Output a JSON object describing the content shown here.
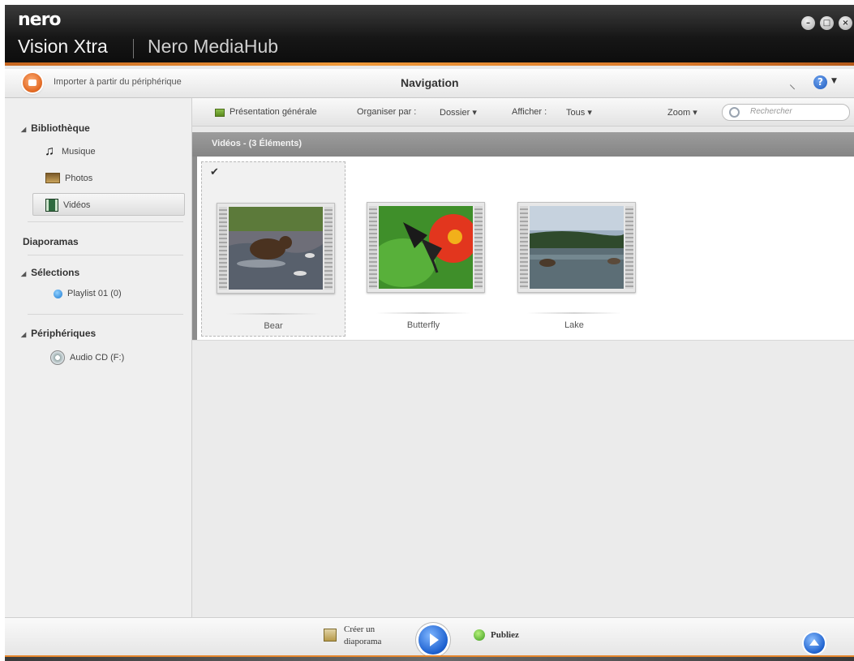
{
  "titlebar": {
    "logo": "nero",
    "app_name": "Vision Xtra",
    "app_secondary": "Nero MediaHub",
    "window_buttons": [
      "minimize-icon",
      "maximize-icon",
      "close-icon"
    ]
  },
  "navbar": {
    "import_label": "Importer à partir du périphérique",
    "title": "Navigation"
  },
  "sidebar": {
    "library_header": "Bibliothèque",
    "library_items": [
      {
        "label": "Musique",
        "icon": "music-note-icon"
      },
      {
        "label": "Photos",
        "icon": "photos-icon"
      },
      {
        "label": "Vidéos",
        "icon": "video-icon",
        "selected": true
      }
    ],
    "slideshows_header": "Diaporamas",
    "selections_header": "Sélections",
    "selections_items": [
      {
        "label": "Playlist 01 (0)",
        "icon": "playlist-icon"
      }
    ],
    "devices_header": "Périphériques",
    "devices_items": [
      {
        "label": "Audio CD (F:)",
        "icon": "cd-drive-icon"
      }
    ]
  },
  "toolbar": {
    "overview": "Présentation générale",
    "organize_label": "Organiser par :",
    "organize_value": "Dossier",
    "show_label": "Afficher :",
    "show_value": "Tous",
    "zoom_label": "Zoom",
    "search_placeholder": "Rechercher"
  },
  "group": {
    "label": "Vidéos - (3 Éléments)"
  },
  "items": [
    {
      "label": "Bear",
      "selected": true,
      "checked": true
    },
    {
      "label": "Butterfly",
      "selected": false
    },
    {
      "label": "Lake",
      "selected": false
    }
  ],
  "bottombar": {
    "create_slideshow_line1": "Créer un",
    "create_slideshow_line2": "diaporama",
    "publish": "Publiez"
  },
  "colors": {
    "accent_orange": "#e5862c",
    "play_blue": "#1b5fcf"
  }
}
